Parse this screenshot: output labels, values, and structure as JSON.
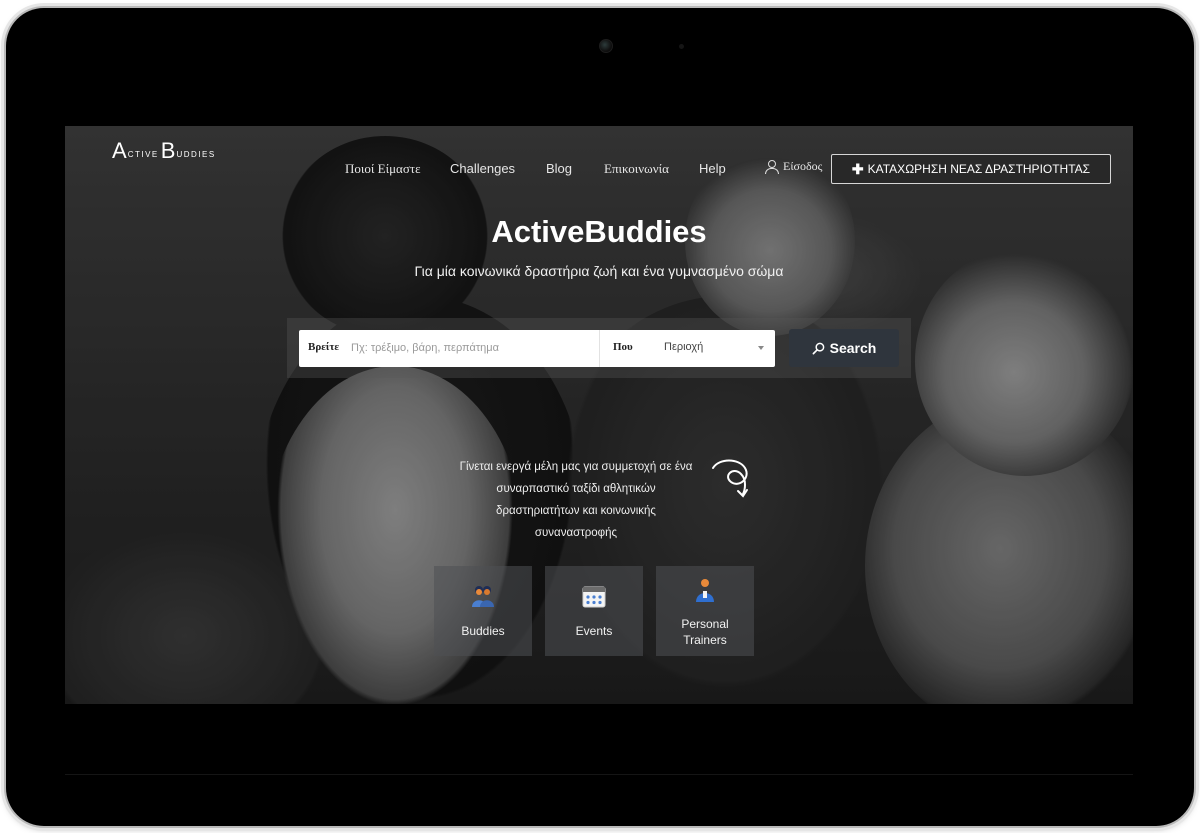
{
  "logo": {
    "a": "A",
    "ctive": "CTIVE",
    "b": "B",
    "uddies": "UDDIES"
  },
  "nav": {
    "about": "Ποιοί Είμαστε",
    "challenges": "Challenges",
    "blog": "Blog",
    "contact": "Επικοινωνία",
    "help": "Help",
    "login": "Είσοδος",
    "cta": "ΚΑΤΑΧΩΡΗΣΗ ΝΕΑΣ ΔΡΑΣΤΗΡΙΟΤΗΤΑΣ"
  },
  "hero": {
    "title": "ActiveBuddies",
    "subtitle": "Για μία κοινωνικά δραστήρια ζωή και ένα γυμνασμένο σώμα"
  },
  "search": {
    "find_label": "Βρείτε",
    "find_placeholder": "Πχ: τρέξιμο, βάρη, περπάτημα",
    "where_label": "Που",
    "area_selected": "Περιοχή",
    "button_label": "Search"
  },
  "join": {
    "line1": "Γίνεται ενεργά μέλη μας για συμμετοχή σε ένα",
    "line2": "συναρπαστικό ταξίδι αθλητικών",
    "line3": "δραστηριατήτων και κοινωνικής",
    "line4": "συναναστροφής"
  },
  "cards": [
    {
      "label": "Buddies",
      "icon": "buddies-icon"
    },
    {
      "label": "Events",
      "icon": "events-icon"
    },
    {
      "label_1": "Personal",
      "label_2": "Trainers",
      "icon": "personal-trainer-icon"
    }
  ],
  "colors": {
    "search_button": "#2f353d",
    "icon_blue": "#4a7fd1",
    "icon_orange": "#e98a3a"
  }
}
